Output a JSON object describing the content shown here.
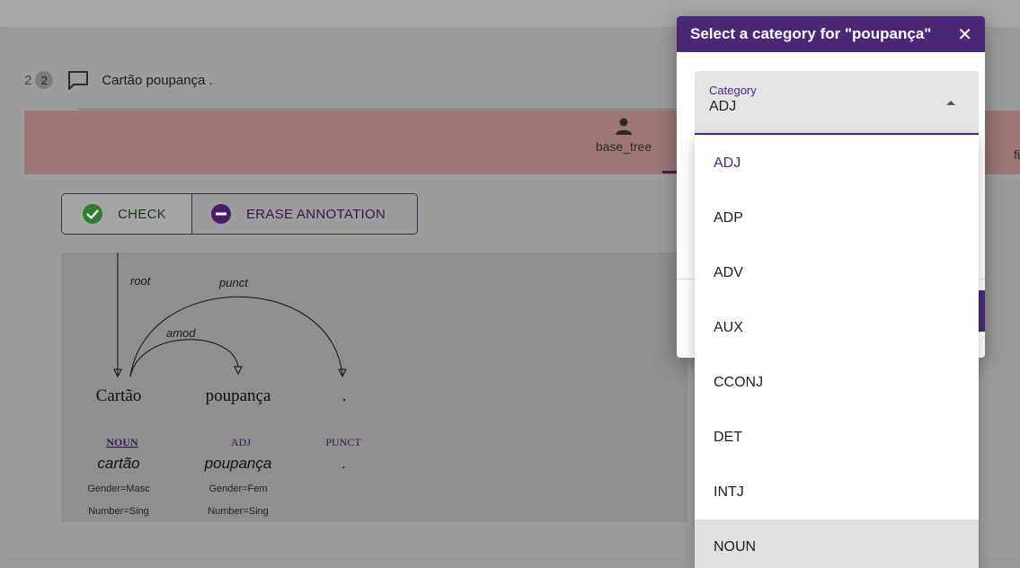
{
  "sentence": {
    "index": "2",
    "badge": "2",
    "text": "Cartão poupança ."
  },
  "tabs": {
    "base_tree": "base_tree",
    "edge_text": "fi"
  },
  "actions": {
    "check_label": "CHECK",
    "erase_label": "ERASE ANNOTATION"
  },
  "tree": {
    "relations": {
      "root": "root",
      "punct": "punct",
      "amod": "amod"
    },
    "tokens": [
      {
        "form": "Cartão",
        "upos": "NOUN",
        "lemma": "cartão",
        "feat1": "Gender=Masc",
        "feat2": "Number=Sing"
      },
      {
        "form": "poupança",
        "upos": "ADJ",
        "lemma": "poupança",
        "feat1": "Gender=Fem",
        "feat2": "Number=Sing"
      },
      {
        "form": ".",
        "upos": "PUNCT",
        "lemma": ".",
        "feat1": "",
        "feat2": ""
      }
    ]
  },
  "dialog": {
    "title": "Select a category for \"poupança\"",
    "close": "✕",
    "field_label": "Category",
    "field_value": "ADJ"
  },
  "options": [
    "ADJ",
    "ADP",
    "ADV",
    "AUX",
    "CCONJ",
    "DET",
    "INTJ",
    "NOUN"
  ],
  "colors": {
    "accent": "#4a2878",
    "check_green": "#2e7d32",
    "erase_purple": "#4a1a6b",
    "tab_bg": "#9b7776"
  }
}
